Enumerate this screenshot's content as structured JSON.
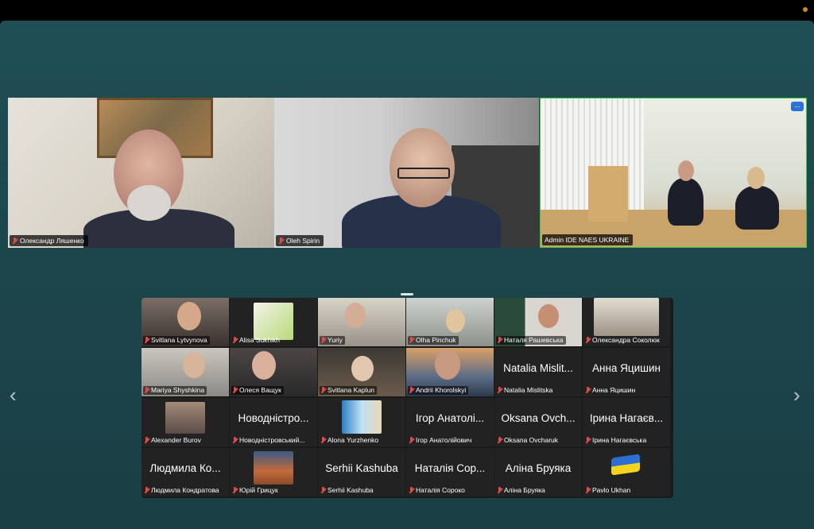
{
  "speakers": [
    {
      "name": "Олександр Ляшенко"
    },
    {
      "name": "Oleh Spirin"
    },
    {
      "name": "Admin IDE NAES UKRAINE"
    }
  ],
  "more_icon": "...",
  "nav": {
    "prev": "‹",
    "next": "›"
  },
  "gallery": [
    {
      "name": "Svitlana Lytvynova",
      "big": ""
    },
    {
      "name": "Alisa Sukhikh",
      "big": ""
    },
    {
      "name": "Yuriy",
      "big": ""
    },
    {
      "name": "Olha Pinchuk",
      "big": ""
    },
    {
      "name": "Наталя Рашевська",
      "big": ""
    },
    {
      "name": "Олександра Соколюк",
      "big": ""
    },
    {
      "name": "Mariya Shyshkina",
      "big": ""
    },
    {
      "name": "Олеся Ващук",
      "big": ""
    },
    {
      "name": "Svitlana Kaplun",
      "big": ""
    },
    {
      "name": "Andrii Khorolskyi",
      "big": ""
    },
    {
      "name": "Natalia Mislitska",
      "big": "Natalia Mislit..."
    },
    {
      "name": "Анна Яцишин",
      "big": "Анна Яцишин"
    },
    {
      "name": "Alexander Burov",
      "big": ""
    },
    {
      "name": "Новоднiстровський...",
      "big": "Новоднiстро..."
    },
    {
      "name": "Alona Yurzhenko",
      "big": ""
    },
    {
      "name": "Iгор Анатолiйович",
      "big": "Iгор Анатолi..."
    },
    {
      "name": "Oksana Ovcharuk",
      "big": "Oksana Ovch..."
    },
    {
      "name": "Iрина Нагаєвська",
      "big": "Iрина Нагаєв..."
    },
    {
      "name": "Людмила Кондратова",
      "big": "Людмила Ко..."
    },
    {
      "name": "Юрiй Грицук",
      "big": ""
    },
    {
      "name": "Serhii Kashuba",
      "big": "Serhii Kashuba"
    },
    {
      "name": "Наталiя Сороко",
      "big": "Наталiя Сор..."
    },
    {
      "name": "Алiна Бруяка",
      "big": "Алiна Бруяка"
    },
    {
      "name": "Pavlo Ukhan",
      "big": ""
    }
  ]
}
